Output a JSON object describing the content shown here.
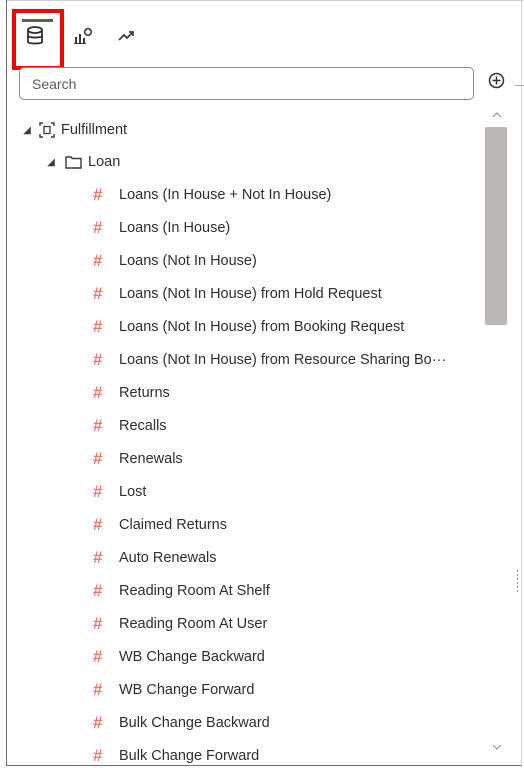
{
  "tabs": [
    {
      "icon": "database-icon",
      "active": true
    },
    {
      "icon": "visualization-icon",
      "active": false
    },
    {
      "icon": "analytics-trend-icon",
      "active": false
    }
  ],
  "search": {
    "placeholder": "Search"
  },
  "tree": {
    "root": {
      "label": "Fulfillment",
      "icon": "subject-area-icon",
      "expanded": true
    },
    "folder": {
      "label": "Loan",
      "icon": "folder-icon",
      "expanded": true
    },
    "measures": [
      "Loans (In House + Not In House)",
      "Loans (In House)",
      "Loans (Not In House)",
      "Loans (Not In House) from Hold Request",
      "Loans (Not In House) from Booking Request",
      "Loans (Not In House) from Resource Sharing Bo···",
      "Returns",
      "Recalls",
      "Renewals",
      "Lost",
      "Claimed Returns",
      "Auto Renewals",
      "Reading Room At Shelf",
      "Reading Room At User",
      "WB Change Backward",
      "WB Change Forward",
      "Bulk Change Backward",
      "Bulk Change Forward"
    ]
  },
  "colors": {
    "measure_hash": "#e87b6e",
    "highlight": "#ff0000",
    "active_tab_bar": "#4a6d4f",
    "scroll_thumb": "#bcb8b4"
  }
}
